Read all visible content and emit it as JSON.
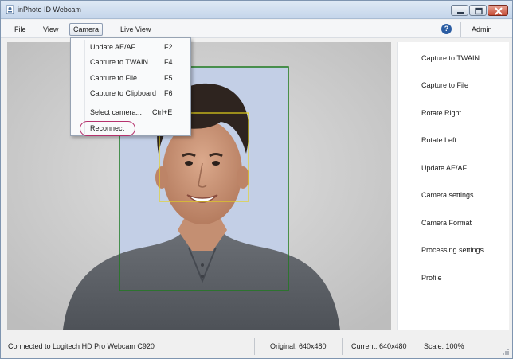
{
  "window": {
    "title": "inPhoto ID Webcam",
    "icon": "webcam-app-icon",
    "controls": [
      "minimize-icon",
      "maximize-icon",
      "close-icon"
    ]
  },
  "menubar": {
    "file": "File",
    "view": "View",
    "camera": "Camera",
    "live_view": "Live View",
    "help_icon": "?",
    "admin": "Admin"
  },
  "camera_menu": {
    "items": [
      {
        "label": "Update AE/AF",
        "shortcut": "F2"
      },
      {
        "label": "Capture to TWAIN",
        "shortcut": "F4"
      },
      {
        "label": "Capture to File",
        "shortcut": "F5"
      },
      {
        "label": "Capture to Clipboard",
        "shortcut": "F6"
      },
      {
        "label": "Select camera...",
        "shortcut": "Ctrl+E"
      },
      {
        "label": "Reconnect",
        "shortcut": ""
      }
    ],
    "highlight_color": "#b5326d"
  },
  "actions": {
    "items": [
      "Capture to TWAIN",
      "Capture to File",
      "Rotate Right",
      "Rotate Left",
      "Update AE/AF",
      "Camera settings",
      "Camera Format",
      "Processing settings",
      "Profile"
    ]
  },
  "preview": {
    "crop_frame_color": "#1e7a1e",
    "face_frame_color": "#e6d51a",
    "background_color": "#c3cfe6"
  },
  "status": {
    "connection": "Connected to Logitech HD Pro Webcam C920",
    "original": "Original: 640x480",
    "current": "Current: 640x480",
    "scale": "Scale: 100%"
  }
}
